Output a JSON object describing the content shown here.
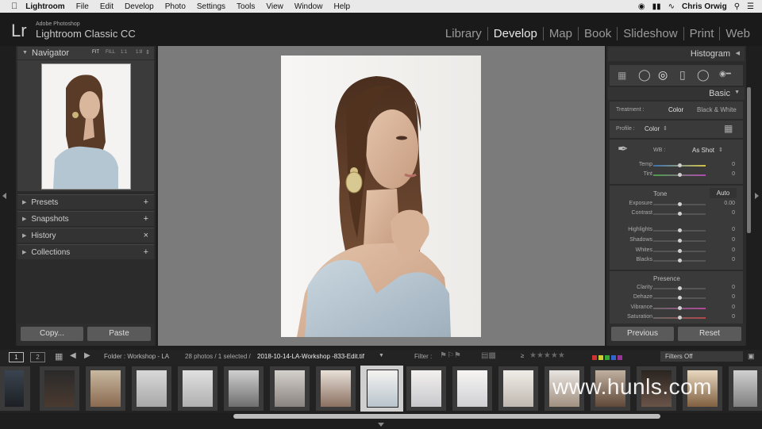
{
  "menubar": {
    "app": "Lightroom",
    "items": [
      "File",
      "Edit",
      "Develop",
      "Photo",
      "Settings",
      "Tools",
      "View",
      "Window",
      "Help"
    ],
    "user": "Chris Orwig"
  },
  "identity": {
    "logo": "Lr",
    "adobe": "Adobe Photoshop",
    "product": "Lightroom Classic CC"
  },
  "modules": [
    "Library",
    "Develop",
    "Map",
    "Book",
    "Slideshow",
    "Print",
    "Web"
  ],
  "left": {
    "navigator": {
      "title": "Navigator",
      "zoom": [
        "FIT",
        "FILL",
        "1:1",
        "1:8"
      ]
    },
    "sections": [
      {
        "label": "Presets",
        "action": "+"
      },
      {
        "label": "Snapshots",
        "action": "+"
      },
      {
        "label": "History",
        "action": "×"
      },
      {
        "label": "Collections",
        "action": "+"
      }
    ],
    "copy": "Copy...",
    "paste": "Paste"
  },
  "right": {
    "histogram": "Histogram",
    "basic": "Basic",
    "treatment_label": "Treatment :",
    "treatment_color": "Color",
    "treatment_bw": "Black & White",
    "profile_label": "Profile :",
    "profile_value": "Color",
    "wb_label": "WB :",
    "wb_value": "As Shot",
    "tone": "Tone",
    "auto": "Auto",
    "presence": "Presence",
    "sliders": [
      {
        "label": "Temp",
        "value": "0",
        "pos": 0.5
      },
      {
        "label": "Tint",
        "value": "0",
        "pos": 0.5
      },
      {
        "label": "Exposure",
        "value": "0.00",
        "pos": 0.5
      },
      {
        "label": "Contrast",
        "value": "0",
        "pos": 0.5
      },
      {
        "label": "Highlights",
        "value": "0",
        "pos": 0.5
      },
      {
        "label": "Shadows",
        "value": "0",
        "pos": 0.5
      },
      {
        "label": "Whites",
        "value": "0",
        "pos": 0.5
      },
      {
        "label": "Blacks",
        "value": "0",
        "pos": 0.5
      },
      {
        "label": "Clarity",
        "value": "0",
        "pos": 0.5
      },
      {
        "label": "Dehaze",
        "value": "0",
        "pos": 0.5
      },
      {
        "label": "Vibrance",
        "value": "0",
        "pos": 0.5
      },
      {
        "label": "Saturation",
        "value": "0",
        "pos": 0.5
      }
    ],
    "previous": "Previous",
    "reset": "Reset"
  },
  "filmtoolbar": {
    "page1": "1",
    "page2": "2",
    "folder": "Folder : Workshop - LA",
    "count": "28 photos / 1 selected /",
    "filename": "2018-10-14-LA-Workshop -833-Edit.tif",
    "filter_label": "Filter :",
    "filters_off": "Filters Off"
  },
  "watermark": "www.hunls.com"
}
